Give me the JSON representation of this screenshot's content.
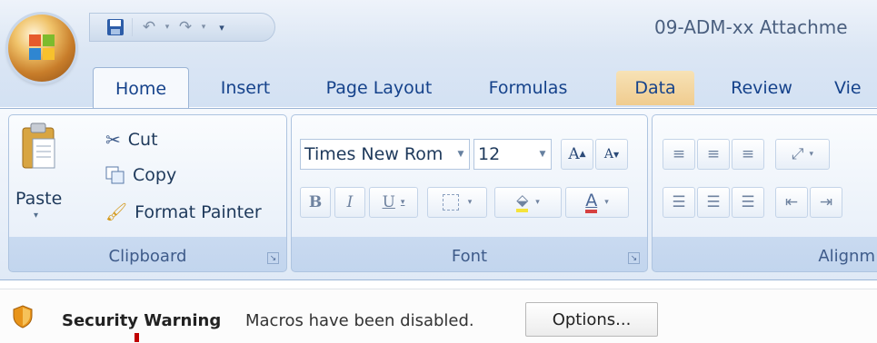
{
  "window": {
    "title": "09-ADM-xx Attachme"
  },
  "quick_access": {
    "save_icon": "save-icon",
    "undo_icon": "undo-icon",
    "redo_icon": "redo-icon",
    "customize_icon": "customize-qat-icon"
  },
  "tabs": [
    {
      "label": "Home",
      "active": true
    },
    {
      "label": "Insert"
    },
    {
      "label": "Page Layout"
    },
    {
      "label": "Formulas"
    },
    {
      "label": "Data"
    },
    {
      "label": "Review"
    },
    {
      "label": "Vie"
    }
  ],
  "clipboard": {
    "paste": "Paste",
    "cut": "Cut",
    "copy": "Copy",
    "format_painter": "Format Painter",
    "label": "Clipboard"
  },
  "font": {
    "name": "Times New Rom",
    "size": "12",
    "grow": "A",
    "shrink": "A",
    "bold": "B",
    "italic": "I",
    "underline": "U",
    "font_color_letter": "A",
    "label": "Font"
  },
  "alignment": {
    "label": "Alignm"
  },
  "security_bar": {
    "title": "Security Warning",
    "message": "Macros have been disabled.",
    "options_button": "Options...",
    "shield_color": "#e8941a"
  },
  "colors": {
    "accent": "#15428b",
    "data_tab": "#f0cc8f",
    "cursor": "#c00000"
  }
}
